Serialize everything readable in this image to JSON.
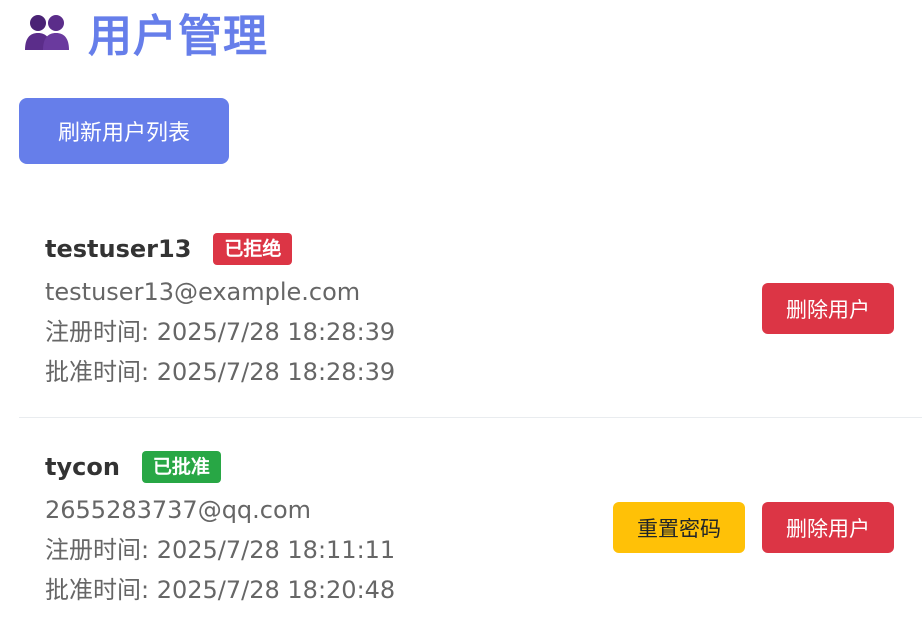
{
  "header": {
    "title": "用户管理",
    "icon": "users-icon",
    "icon_color": "#5b2d8a"
  },
  "toolbar": {
    "refresh_label": "刷新用户列表"
  },
  "colors": {
    "primary": "#667eea",
    "danger": "#dc3545",
    "success": "#28a745",
    "warning": "#ffc107"
  },
  "users": [
    {
      "username": "testuser13",
      "status": "已拒绝",
      "email": "testuser13@example.com",
      "registered": "注册时间: 2025/7/28 18:28:39",
      "approved": "批准时间: 2025/7/28 18:28:39",
      "delete_label": "删除用户"
    },
    {
      "username": "tycon",
      "status": "已批准",
      "email": "2655283737@qq.com",
      "registered": "注册时间: 2025/7/28 18:11:11",
      "approved": "批准时间: 2025/7/28 18:20:48",
      "reset_label": "重置密码",
      "delete_label": "删除用户"
    }
  ]
}
